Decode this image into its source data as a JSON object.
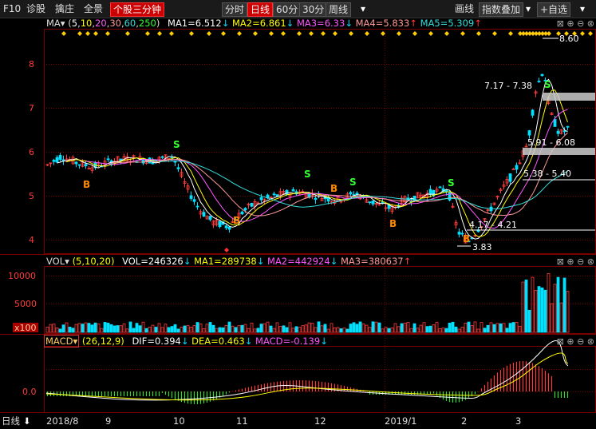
{
  "toolbar": {
    "f10": "F10",
    "diag": "诊股",
    "select": "擒庄",
    "full": "全景",
    "minute3": "个股三分钟",
    "fenshi": "分时",
    "rixian": "日线",
    "m60": "60分",
    "m30": "30分",
    "zhouxian": "周线",
    "huaxian": "画线",
    "overlay": "指数叠加",
    "custom": "+自选"
  },
  "ma_legend": {
    "name": "MA",
    "params_pre": "(",
    "p1": "5",
    "p2": "10",
    "p3": "20",
    "p4": "30",
    "p5": "60",
    "p6": "250",
    "params_post": ")",
    "ma1": "MA1=6.512",
    "ma2": "MA2=6.861",
    "ma3": "MA3=6.33",
    "ma4": "MA4=5.833",
    "ma5": "MA5=5.309"
  },
  "vol_legend": {
    "name": "VOL",
    "params": "(5,10,20)",
    "vol": "VOL=246326",
    "ma1": "MA1=289738",
    "ma2": "MA2=442924",
    "ma3": "MA3=380637"
  },
  "macd_legend": {
    "name": "MACD",
    "params": "(26,12,9)",
    "dif": "DIF=0.394",
    "dea": "DEA=0.463",
    "macd": "MACD=-0.139"
  },
  "price_axis": [
    "8",
    "7",
    "6",
    "5",
    "4"
  ],
  "vol_axis": [
    "10000",
    "5000",
    "x100"
  ],
  "macd_axis": [
    "0.0"
  ],
  "date_axis": {
    "period": "日线",
    "labels": [
      "2018/8",
      "9",
      "10",
      "11",
      "12",
      "2019/1",
      "2",
      "3"
    ]
  },
  "annotations": {
    "high": "8.60",
    "low": "3.83",
    "range1": "7.17 - 7.38",
    "range2": "5.91 - 6.08",
    "range3": "5.38 - 5.40",
    "range4": "4.17 - 4.21"
  },
  "signals": {
    "buy": "B",
    "sell": "S"
  },
  "colors": {
    "up": "#ff3c3c",
    "down": "#00e0ff",
    "ma1": "#ffffff",
    "ma2": "#ffff00",
    "ma3": "#ff55ff",
    "ma4": "#ff9999",
    "ma5": "#33dddd",
    "grid": "#7a0000"
  },
  "chart_data": {
    "type": "candlestick",
    "ylim": [
      3.6,
      8.8
    ],
    "x": [
      "2018/8",
      "9",
      "10",
      "11",
      "12",
      "2019/1",
      "2",
      "3"
    ]
  }
}
